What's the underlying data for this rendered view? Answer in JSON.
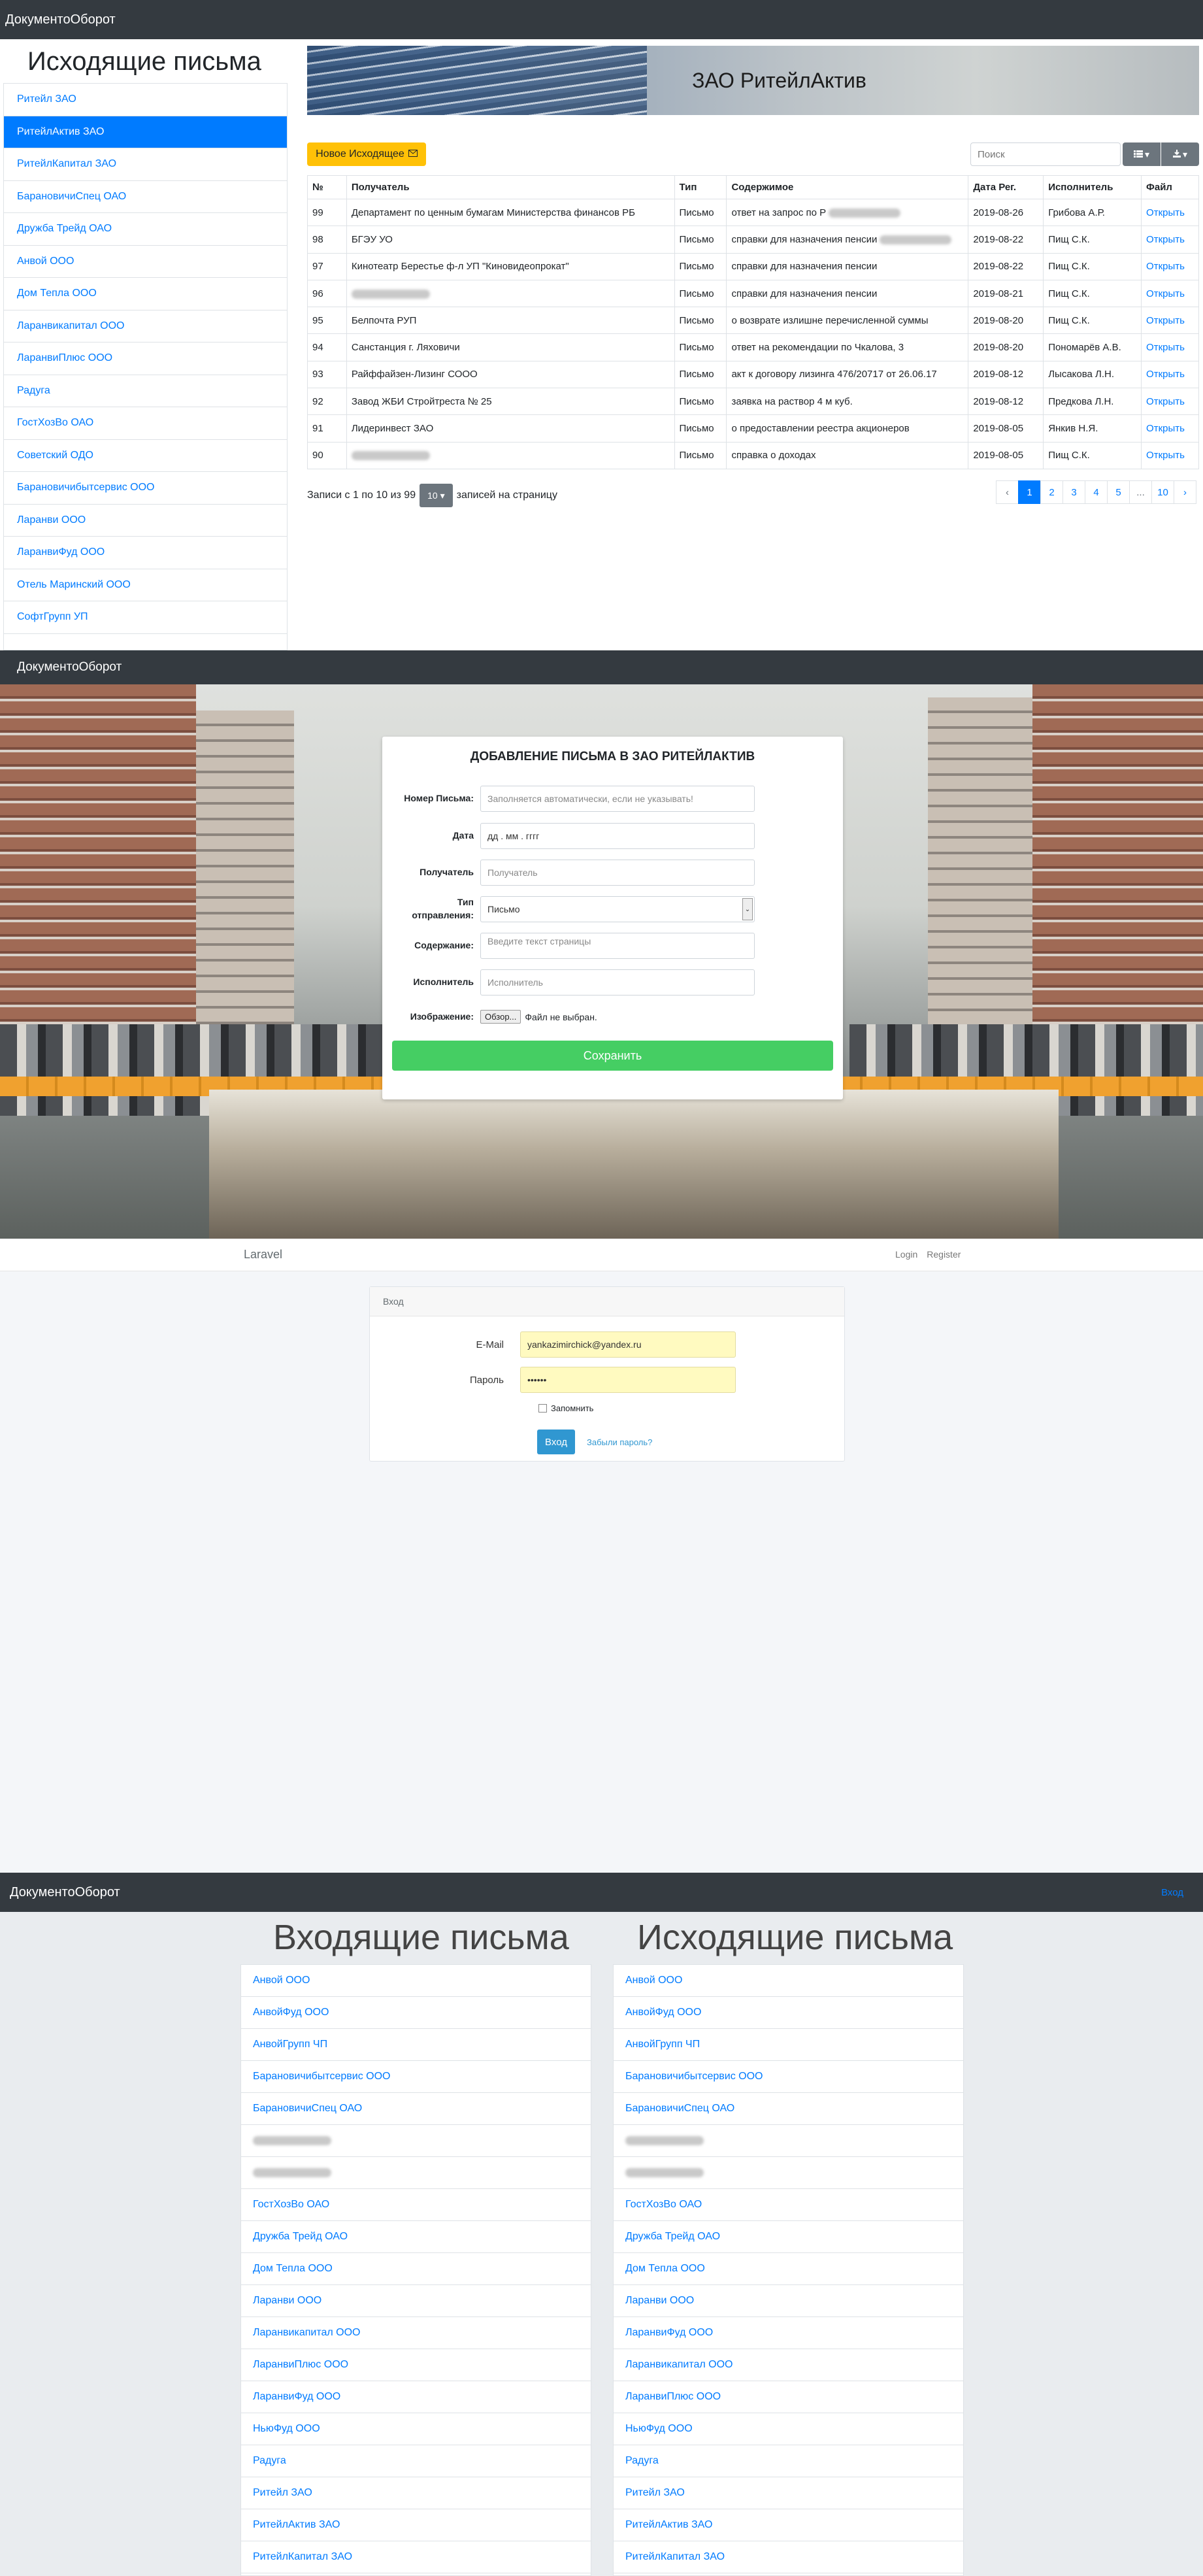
{
  "s1": {
    "brand": "ДокументоОборот",
    "sidebar_title": "Исходящие письма",
    "sidebar": [
      "Ритейл ЗАО",
      "РитейлАктив ЗАО",
      "РитейлКапитал ЗАО",
      "БарановичиСпец ОАО",
      "Дружба Трейд ОАО",
      "Анвой ООО",
      "Дом Тепла ООО",
      "Ларанвикапитал ООО",
      "ЛаранвиПлюс ООО",
      "Радуга",
      "ГостХозВо ОАО",
      "Советский ОДО",
      "Барановичибытсервис ООО",
      "Ларанви ООО",
      "ЛаранвиФуд ООО",
      "Отель Маринский ООО",
      "СофтГрупп УП"
    ],
    "banner_title": "ЗАО РитейлАктив",
    "new_button": "Новое Исходящее",
    "search_placeholder": "Поиск",
    "columns": [
      "№",
      "Получатель",
      "Тип",
      "Содержимое",
      "Дата Рег.",
      "Исполнитель",
      "Файл"
    ],
    "rows": [
      [
        "99",
        "Департамент по ценным бумагам Министерства финансов РБ",
        "Письмо",
        "ответ на запрос по Р",
        "2019-08-26",
        "Грибова А.Р.",
        "Открыть"
      ],
      [
        "98",
        "БГЭУ УО",
        "Письмо",
        "справки для назначения пенсии",
        "2019-08-22",
        "Пищ С.К.",
        "Открыть"
      ],
      [
        "97",
        "Кинотеатр Берестье ф-л УП \"Киновидеопрокат\"",
        "Письмо",
        "справки для назначения пенсии",
        "2019-08-22",
        "Пищ С.К.",
        "Открыть"
      ],
      [
        "96",
        "",
        "Письмо",
        "справки для назначения пенсии",
        "2019-08-21",
        "Пищ С.К.",
        "Открыть"
      ],
      [
        "95",
        "Белпочта РУП",
        "Письмо",
        "о возврате излишне перечисленной суммы",
        "2019-08-20",
        "Пищ С.К.",
        "Открыть"
      ],
      [
        "94",
        "Санстанция г. Ляховичи",
        "Письмо",
        "ответ на рекомендации по Чкалова, 3",
        "2019-08-20",
        "Пономарёв А.В.",
        "Открыть"
      ],
      [
        "93",
        "Райффайзен-Лизинг СООО",
        "Письмо",
        "акт к договору лизинга 476/20717 от 26.06.17",
        "2019-08-12",
        "Лысакова Л.Н.",
        "Открыть"
      ],
      [
        "92",
        "Завод ЖБИ Стройтреста № 25",
        "Письмо",
        "заявка на раствор 4 м куб.",
        "2019-08-12",
        "Предкова Л.Н.",
        "Открыть"
      ],
      [
        "91",
        "Лидеринвест ЗАО",
        "Письмо",
        "о предоставлении реестра акционеров",
        "2019-08-05",
        "Янкив Н.Я.",
        "Открыть"
      ],
      [
        "90",
        "",
        "Письмо",
        "справка о доходах",
        "2019-08-05",
        "Пищ С.К.",
        "Открыть"
      ]
    ],
    "pag_info_pre": "Записи с 1 по 10 из 99",
    "page_size": "10",
    "pag_info_post": "записей на страницу",
    "pages": [
      "‹",
      "1",
      "2",
      "3",
      "4",
      "5",
      "...",
      "10",
      "›"
    ]
  },
  "s2": {
    "brand": "ДокументоОборот",
    "title": "ДОБАВЛЕНИЕ ПИСЬМА В ЗАО РИТЕЙЛАКТИВ",
    "f_num_label": "Номер Письма:",
    "f_num_ph": "Заполняется автоматически, если не указывать!",
    "f_date_label": "Дата",
    "f_date_ph": "дд . мм . гггг",
    "f_rec_label": "Получатель",
    "f_rec_ph": "Получатель",
    "f_type_label": "Тип отправления:",
    "f_type_val": "Письмо",
    "f_content_label": "Содержание:",
    "f_content_ph": "Введите текст страницы",
    "f_exec_label": "Исполнитель",
    "f_exec_ph": "Исполнитель",
    "f_img_label": "Изображение:",
    "browse": "Обзор...",
    "no_file": "Файл не выбран.",
    "save": "Сохранить"
  },
  "s3": {
    "brand": "Laravel",
    "login_link": "Login",
    "register_link": "Register",
    "card_title": "Вход",
    "email_label": "E-Mail",
    "email_value": "yankazimirchick@yandex.ru",
    "password_label": "Пароль",
    "password_value": "••••••",
    "remember": "Запомнить",
    "submit": "Вход",
    "forgot": "Забыли пароль?"
  },
  "s4": {
    "brand": "ДокументоОборот",
    "login": "Вход",
    "incoming_title": "Входящие письма",
    "outgoing_title": "Исходящие письма",
    "incoming": [
      "Анвой ООО",
      "АнвойФуд ООО",
      "АнвойГрупп ЧП",
      "Барановичибытсервис ООО",
      "БарановичиСпец ОАО",
      "",
      "",
      "ГостХозВо ОАО",
      "Дружба Трейд ОАО",
      "Дом Тепла ООО",
      "Ларанви ООО",
      "Ларанвикапитал ООО",
      "ЛаранвиПлюс ООО",
      "ЛаранвиФуд ООО",
      "НьюФуд ООО",
      "Радуга",
      "Ритейл ЗАО",
      "РитейлАктив ЗАО",
      "РитейлКапитал ЗАО"
    ],
    "outgoing": [
      "Анвой ООО",
      "АнвойФуд ООО",
      "АнвойГрупп ЧП",
      "Барановичибытсервис ООО",
      "БарановичиСпец ОАО",
      "",
      "",
      "ГостХозВо ОАО",
      "Дружба Трейд ОАО",
      "Дом Тепла ООО",
      "Ларанви ООО",
      "ЛаранвиФуд ООО",
      "Ларанвикапитал ООО",
      "ЛаранвиПлюс ООО",
      "НьюФуд ООО",
      "Радуга",
      "Ритейл ЗАО",
      "РитейлАктив ЗАО",
      "РитейлКапитал ЗАО"
    ]
  }
}
